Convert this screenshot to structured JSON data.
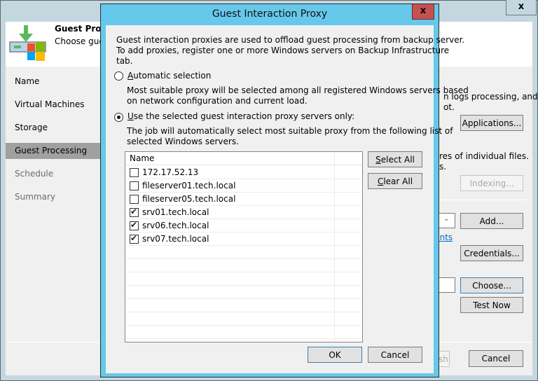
{
  "wizard": {
    "title": "Guest Proce",
    "subtitle": "Choose gue:",
    "close_label": "x",
    "nav": [
      {
        "label": "Name",
        "state": "normal"
      },
      {
        "label": "Virtual Machines",
        "state": "normal"
      },
      {
        "label": "Storage",
        "state": "normal"
      },
      {
        "label": "Guest Processing",
        "state": "active"
      },
      {
        "label": "Schedule",
        "state": "disabled"
      },
      {
        "label": "Summary",
        "state": "disabled"
      }
    ],
    "right_text": {
      "line1": "n logs processing, and",
      "line2": "ot.",
      "line3": "res of individual files.",
      "line4": "s."
    },
    "link_fragment": "unts",
    "buttons": {
      "applications": "Applications...",
      "indexing": "Indexing...",
      "add": "Add...",
      "credentials": "Credentials...",
      "choose": "Choose...",
      "test_now": "Test Now",
      "finish_fragment": "sh",
      "cancel": "Cancel"
    }
  },
  "dialog": {
    "title": "Guest Interaction Proxy",
    "close_label": "x",
    "intro": [
      "Guest interaction proxies are used to offload guest processing from backup server.",
      "To add proxies, register one or more Windows servers on Backup Infrastructure",
      "tab."
    ],
    "options": [
      {
        "accel": "A",
        "label_rest": "utomatic selection",
        "checked": false,
        "description": [
          "Most suitable proxy will be selected among all registered Windows servers based",
          "on network configuration and current load."
        ]
      },
      {
        "accel": "U",
        "label_rest": "se the selected guest interaction proxy servers only:",
        "checked": true,
        "description": [
          "The job will automatically select most suitable proxy from the following list of",
          "selected Windows servers."
        ]
      }
    ],
    "list": {
      "column_header": "Name",
      "rows": [
        {
          "name": "172.17.52.13",
          "checked": false
        },
        {
          "name": "fileserver01.tech.local",
          "checked": false
        },
        {
          "name": "fileserver05.tech.local",
          "checked": false
        },
        {
          "name": "srv01.tech.local",
          "checked": true
        },
        {
          "name": "srv06.tech.local",
          "checked": true
        },
        {
          "name": "srv07.tech.local",
          "checked": true
        }
      ]
    },
    "select_all": {
      "accel": "S",
      "rest": "elect All"
    },
    "clear_all": {
      "accel": "C",
      "rest": "lear All"
    },
    "ok_label": "OK",
    "cancel_label": "Cancel"
  }
}
